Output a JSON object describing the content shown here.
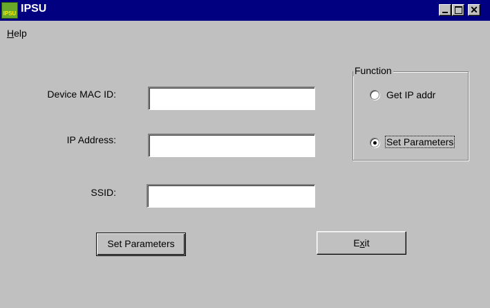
{
  "window": {
    "title": "IPSU",
    "icon_text": "IPSU",
    "controls": [
      "minimize-icon",
      "maximize-icon",
      "close-icon"
    ],
    "close_glyph": "✕"
  },
  "menu": {
    "items": [
      {
        "label": "Help",
        "mnemonic": "H",
        "rest": "elp"
      }
    ]
  },
  "form": {
    "mac_label": "Device MAC ID:",
    "mac_value": "",
    "ip_label": "IP Address:",
    "ip_value": "",
    "ssid_label": "SSID:",
    "ssid_value": ""
  },
  "function_group": {
    "title": "Function",
    "options": [
      {
        "label": "Get IP addr",
        "selected": false
      },
      {
        "label": "Set Parameters",
        "selected": true
      }
    ]
  },
  "buttons": {
    "set_parameters": "Set Parameters",
    "exit": {
      "label": "Exit",
      "mnemonic_pre": "E",
      "mnemonic": "x",
      "mnemonic_post": "it"
    }
  },
  "colors": {
    "titlebar": "#000080",
    "face": "#c0c0c0",
    "title_text": "#ffffff"
  }
}
